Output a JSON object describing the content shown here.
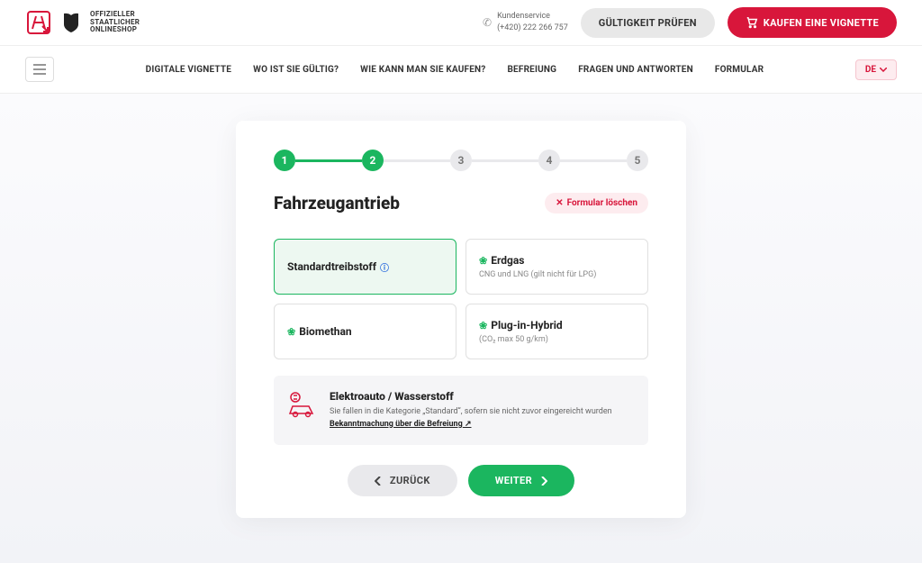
{
  "header": {
    "logo_label": "OFFIZIELLER\nSTAATLICHER\nONLINESHOP",
    "kunden_label": "Kundenservice",
    "kunden_phone": "(+420) 222 266 757",
    "check_btn": "GÜLTIGKEIT PRÜFEN",
    "buy_btn": "KAUFEN EINE VIGNETTE"
  },
  "nav": {
    "items": [
      "DIGITALE VIGNETTE",
      "WO IST SIE GÜLTIG?",
      "WIE KANN MAN SIE KAUFEN?",
      "BEFREIUNG",
      "FRAGEN UND ANTWORTEN",
      "FORMULAR"
    ],
    "lang": "DE"
  },
  "wizard": {
    "steps": [
      "1",
      "2",
      "3",
      "4",
      "5"
    ],
    "current": 2,
    "title": "Fahrzeugantrieb",
    "clear_label": "Formular löschen",
    "options": [
      {
        "title": "Standardtreibstoff",
        "sub": "",
        "selected": true,
        "leaf": false,
        "info": true
      },
      {
        "title": "Erdgas",
        "sub": "CNG und LNG (gilt nicht für LPG)",
        "selected": false,
        "leaf": true,
        "info": false
      },
      {
        "title": "Biomethan",
        "sub": "",
        "selected": false,
        "leaf": true,
        "info": false
      },
      {
        "title": "Plug-in-Hybrid",
        "sub": "(CO₂ max 50 g/km)",
        "selected": false,
        "leaf": true,
        "info": false
      }
    ],
    "elec": {
      "title": "Elektroauto / Wasserstoff",
      "desc_pre": "Sie fallen in die Kategorie „Standard“, sofern sie nicht zuvor eingereicht wurden ",
      "desc_link": "Bekanntmachung über die Befreiung"
    },
    "back": "ZURÜCK",
    "next": "WEITER"
  }
}
